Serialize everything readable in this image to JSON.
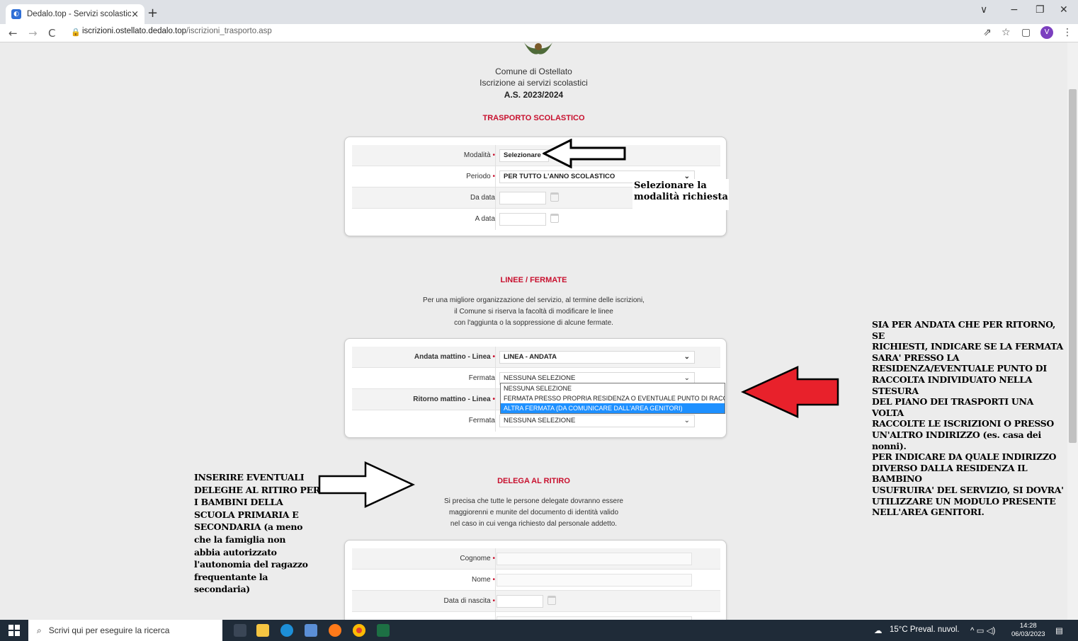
{
  "browser": {
    "tab_title": "Dedalo.top - Servizi scolastici",
    "tab_close": "×",
    "new_tab": "+",
    "url_host": "iscrizioni.ostellato.dedalo.top",
    "url_path": "/iscrizioni_trasporto.asp",
    "avatar_letter": "V",
    "controls": {
      "back": "←",
      "forward": "→",
      "reload": "C",
      "minimize": "−",
      "restore": "❐",
      "close": "✕",
      "collapse": "∨",
      "share": "⇗",
      "star": "☆",
      "sidepanel": "▢",
      "menu": "⋮"
    }
  },
  "header": {
    "town": "Comune di Ostellato",
    "subtitle": "Iscrizione ai servizi scolastici",
    "year": "A.S. 2023/2024"
  },
  "transport": {
    "title": "TRASPORTO SCOLASTICO",
    "rows": [
      {
        "label": "Modalità",
        "value": "Selezionare"
      },
      {
        "label": "Periodo",
        "value": "PER TUTTO L'ANNO SCOLASTICO"
      },
      {
        "label": "Da data",
        "value": ""
      },
      {
        "label": "A data",
        "value": ""
      }
    ]
  },
  "lines": {
    "title": "LINEE / FERMATE",
    "note": [
      "Per una migliore organizzazione del servizio, al termine delle iscrizioni,",
      "il Comune si riserva la facoltà di modificare le linee",
      "con l'aggiunta o la soppressione di alcune fermate."
    ],
    "rows": [
      {
        "label": "Andata mattino - Linea",
        "value": "LINEA - ANDATA"
      },
      {
        "label": "Fermata",
        "value": "NESSUNA SELEZIONE"
      },
      {
        "label": "Ritorno mattino - Linea",
        "value": ""
      },
      {
        "label": "Fermata",
        "value": "NESSUNA SELEZIONE"
      }
    ],
    "dropdown_options": [
      "NESSUNA SELEZIONE",
      "FERMATA PRESSO PROPRIA RESIDENZA O EVENTUALE PUNTO DI RACCOLTA",
      "ALTRA FERMATA (DA COMUNICARE DALL'AREA GENITORI)"
    ]
  },
  "delegate": {
    "title": "DELEGA AL RITIRO",
    "note": [
      "Si precisa che tutte le persone delegate dovranno essere",
      "maggiorenni e munite del documento di identità valido",
      "nel caso in cui venga richiesto dal personale addetto."
    ],
    "rows": [
      {
        "label": "Cognome"
      },
      {
        "label": "Nome"
      },
      {
        "label": "Data di nascita"
      }
    ]
  },
  "annotations": {
    "modalita_callout": [
      "Selezionare la",
      "modalità richiesta"
    ],
    "right_note": [
      "SIA PER ANDATA CHE PER RITORNO, SE",
      "RICHIESTI, INDICARE SE LA FERMATA",
      "SARA' PRESSO LA",
      "RESIDENZA/EVENTUALE PUNTO DI",
      "RACCOLTA INDIVIDUATO NELLA STESURA",
      "DEL PIANO DEI TRASPORTI UNA VOLTA",
      "RACCOLTE LE ISCRIZIONI O PRESSO",
      "UN'ALTRO INDIRIZZO (es. casa dei",
      "nonni).",
      "PER INDICARE DA QUALE INDIRIZZO",
      "DIVERSO DALLA RESIDENZA IL BAMBINO",
      "USUFRUIRA' DEL SERVIZIO, SI DOVRA'",
      "UTILIZZARE UN MODULO PRESENTE",
      "NELL'AREA GENITORI."
    ],
    "left_note": [
      "INSERIRE EVENTUALI",
      "DELEGHE AL RITIRO PER",
      "I BAMBINI DELLA",
      "SCUOLA PRIMARIA E",
      "SECONDARIA (a meno",
      "che la famiglia non",
      "abbia autorizzato",
      "l'autonomia del ragazzo",
      "frequentante la",
      "secondaria)"
    ]
  },
  "taskbar": {
    "search_placeholder": "Scrivi qui per eseguire la ricerca",
    "weather": "15°C  Preval. nuvol.",
    "time": "14:28",
    "date": "06/03/2023"
  },
  "colors": {
    "accent_red": "#c8102e",
    "arrow_red": "#e8212b",
    "selection_blue": "#1e90ff",
    "taskbar": "#1f2b38"
  }
}
